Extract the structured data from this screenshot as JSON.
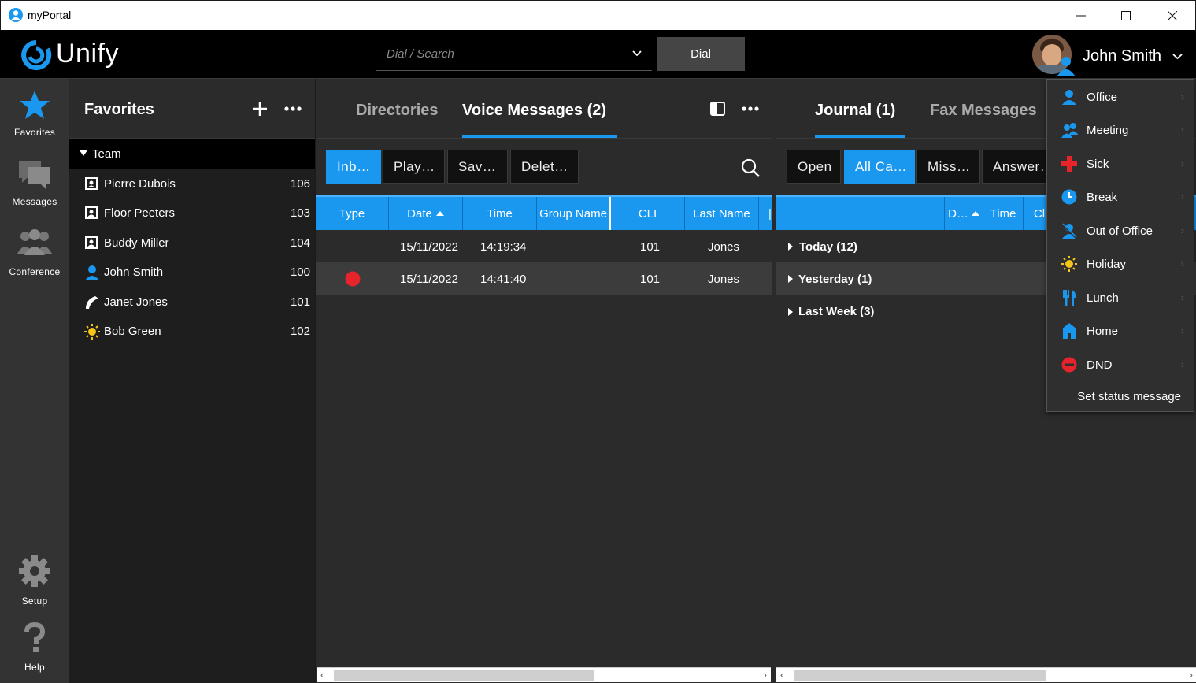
{
  "window": {
    "title": "myPortal"
  },
  "header": {
    "brand": "Unify",
    "search_placeholder": "Dial / Search",
    "dial_label": "Dial",
    "user_name": "John Smith"
  },
  "leftnav": {
    "favorites": "Favorites",
    "messages": "Messages",
    "conference": "Conference",
    "setup": "Setup",
    "help": "Help"
  },
  "favorites": {
    "title": "Favorites",
    "group": "Team",
    "contacts": [
      {
        "name": "Pierre Dubois",
        "ext": "106",
        "icon": "contact-card-icon"
      },
      {
        "name": "Floor Peeters",
        "ext": "103",
        "icon": "contact-card-icon"
      },
      {
        "name": "Buddy Miller",
        "ext": "104",
        "icon": "contact-card-icon"
      },
      {
        "name": "John Smith",
        "ext": "100",
        "icon": "person-office-icon"
      },
      {
        "name": "Janet Jones",
        "ext": "101",
        "icon": "handset-on-call-icon"
      },
      {
        "name": "Bob Green",
        "ext": "102",
        "icon": "sun-holiday-icon"
      }
    ]
  },
  "center": {
    "tabs": [
      "Directories",
      "Voice Messages (2)"
    ],
    "toolbar": [
      "Inb…",
      "Play…",
      "Sav…",
      "Delet…"
    ],
    "columns": [
      "Type",
      "Date",
      "Time",
      "Group Name",
      "CLI",
      "Last Name"
    ],
    "rows": [
      {
        "type": "",
        "date": "15/11/2022",
        "time": "14:19:34",
        "group": "",
        "cli": "101",
        "last": "Jones"
      },
      {
        "type": "red-dot",
        "date": "15/11/2022",
        "time": "14:41:40",
        "group": "",
        "cli": "101",
        "last": "Jones"
      }
    ]
  },
  "right": {
    "tabs": [
      "Journal (1)",
      "Fax Messages"
    ],
    "toolbar": [
      "Open",
      "All Ca…",
      "Miss…",
      "Answer…"
    ],
    "columns": [
      "D…",
      "Time",
      "Cl"
    ],
    "groups": [
      "Today (12)",
      "Yesterday (1)",
      "Last Week (3)"
    ]
  },
  "status_menu": {
    "items": [
      {
        "label": "Office",
        "icon": "person-icon",
        "color": "#1a98f0"
      },
      {
        "label": "Meeting",
        "icon": "meeting-icon",
        "color": "#1a98f0"
      },
      {
        "label": "Sick",
        "icon": "red-cross-icon",
        "color": "#e8242b"
      },
      {
        "label": "Break",
        "icon": "clock-icon",
        "color": "#1a98f0"
      },
      {
        "label": "Out of Office",
        "icon": "person-crossed-icon",
        "color": "#1a98f0"
      },
      {
        "label": "Holiday",
        "icon": "sun-icon",
        "color": "#f5c518"
      },
      {
        "label": "Lunch",
        "icon": "cutlery-icon",
        "color": "#1a98f0"
      },
      {
        "label": "Home",
        "icon": "home-icon",
        "color": "#1a98f0"
      },
      {
        "label": "DND",
        "icon": "do-not-disturb-icon",
        "color": "#e8242b"
      }
    ],
    "footer": "Set status message"
  },
  "colors": {
    "accent": "#1a98f0",
    "red": "#e8242b",
    "yellow": "#f5c518"
  }
}
